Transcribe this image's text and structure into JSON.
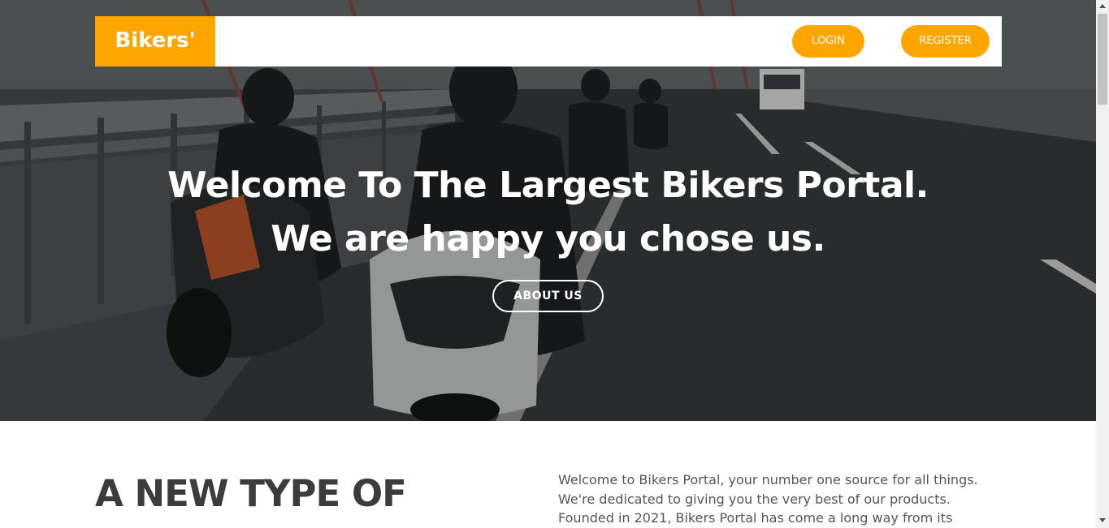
{
  "brand": {
    "name": "Bikers'",
    "color": "#ffa500"
  },
  "nav": {
    "login_label": "LOGIN",
    "register_label": "REGISTER"
  },
  "hero": {
    "title_line1": "Welcome To The Largest Bikers Portal.",
    "title_line2": "We are happy you chose us.",
    "about_label": "ABOUT US",
    "image_semantic": "bikers-riding-on-bridge-photo"
  },
  "content": {
    "heading": "A NEW TYPE OF",
    "intro": "Welcome to Bikers Portal, your number one source for all things. We're dedicated to giving you the very best of our products. Founded in 2021, Bikers Portal has come a long way from its beginnings. We now serve"
  },
  "colors": {
    "accent": "#ffa500",
    "heading_text": "#3c3c3c",
    "body_text": "#555555"
  }
}
